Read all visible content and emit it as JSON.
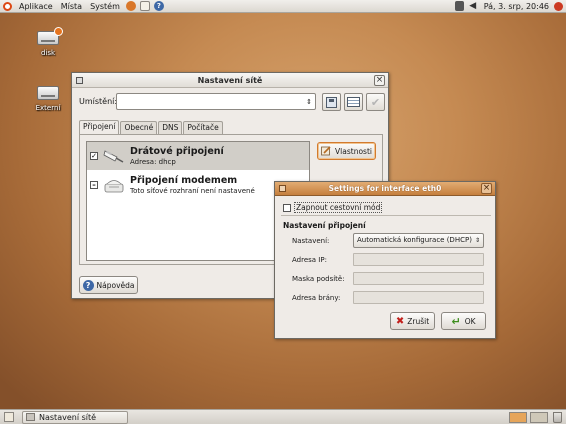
{
  "top_panel": {
    "menus": [
      "Aplikace",
      "Místa",
      "Systém"
    ],
    "clock": "Pá, 3. srp, 20:46"
  },
  "desktop_icons": [
    {
      "label": "disk"
    },
    {
      "label": "Externí"
    }
  ],
  "main_window": {
    "title": "Nastavení sítě",
    "location_label": "Umístění:",
    "location_value": "",
    "tabs": [
      {
        "label": "Připojení",
        "active": true
      },
      {
        "label": "Obecné",
        "active": false
      },
      {
        "label": "DNS",
        "active": false
      },
      {
        "label": "Počítače",
        "active": false
      }
    ],
    "connections": [
      {
        "name": "Drátové připojení",
        "detail": "Adresa: dhcp",
        "checked": true,
        "selected": true
      },
      {
        "name": "Připojení modemem",
        "detail": "Toto síťové rozhraní není nastavené",
        "checked": false,
        "selected": false
      }
    ],
    "properties_button": "Vlastnosti",
    "help_button": "Nápověda"
  },
  "dialog": {
    "title": "Settings for interface eth0",
    "roaming_label": "Zapnout cestovní mód",
    "section_title": "Nastavení připojení",
    "config_label": "Nastavení:",
    "config_value": "Automatická konfigurace (DHCP)",
    "ip_label": "Adresa IP:",
    "ip_value": "",
    "mask_label": "Maska podsítě:",
    "mask_value": "",
    "gateway_label": "Adresa brány:",
    "gateway_value": "",
    "cancel_button": "Zrušit",
    "ok_button": "OK"
  },
  "bottom_panel": {
    "task": "Nastavení sítě"
  },
  "colors": {
    "accent": "#dd4814",
    "dialog_title": "#c57f3e"
  }
}
